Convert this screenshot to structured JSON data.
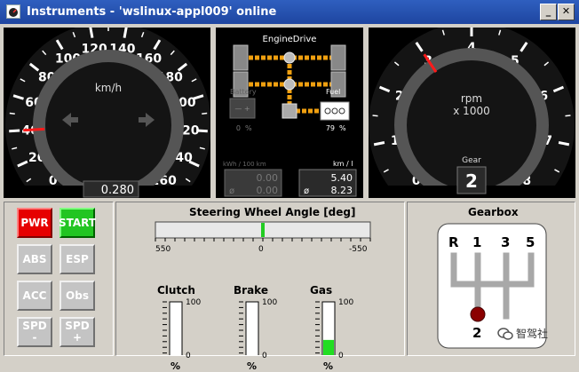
{
  "window": {
    "title": "Instruments - 'wslinux-appl009' online",
    "min_glyph": "_",
    "close_glyph": "✕"
  },
  "speedometer": {
    "unit": "km/h",
    "ticks": [
      "0",
      "20",
      "40",
      "60",
      "80",
      "100",
      "120",
      "140",
      "160",
      "180",
      "200",
      "220",
      "240",
      "260"
    ],
    "needle_value": 40,
    "odometer": "0.280"
  },
  "tachometer": {
    "unit": "rpm",
    "unit_multiplier": "x 1000",
    "ticks": [
      "0",
      "1",
      "2",
      "3",
      "4",
      "5",
      "6",
      "7",
      "8"
    ],
    "needle_value": 3,
    "gear_label": "Gear",
    "gear_value": "2"
  },
  "engine_drive": {
    "title": "EngineDrive",
    "battery_label": "Battery",
    "battery_value": "0",
    "battery_unit": "%",
    "fuel_label": "Fuel",
    "fuel_value": "79",
    "fuel_unit": "%",
    "kwh_label": "kWh / 100 km",
    "kwh_value": "0.00",
    "kwh_avg": "0.00",
    "kml_label": "km / l",
    "kml_value": "5.40",
    "kml_avg": "8.23",
    "avg_symbol": "ø",
    "battery_terminals": "— +"
  },
  "controls": {
    "buttons": [
      "PWR",
      "START",
      "ABS",
      "ESP",
      "ACC",
      "Obs"
    ],
    "spd_minus": [
      "SPD",
      "-"
    ],
    "spd_plus": [
      "SPD",
      "+"
    ]
  },
  "steering": {
    "title": "Steering Wheel Angle [deg]",
    "left_label": "550",
    "center_label": "0",
    "right_label": "-550",
    "value_deg": 0
  },
  "pedals": [
    {
      "name": "Clutch",
      "max_label": "100",
      "min_label": "0",
      "unit": "%",
      "value": 0
    },
    {
      "name": "Brake",
      "max_label": "100",
      "min_label": "0",
      "unit": "%",
      "value": 0
    },
    {
      "name": "Gas",
      "max_label": "100",
      "min_label": "0",
      "unit": "%",
      "value": 0.33,
      "fill_color": "#22dd22"
    }
  ],
  "gearbox": {
    "title": "Gearbox",
    "top_labels": [
      "R",
      "1",
      "3",
      "5"
    ],
    "bottom_labels": [
      "2"
    ],
    "current_gear": "2",
    "knob_color": "#8b0000"
  },
  "watermark": "智驾社",
  "colors": {
    "accent_red": "#ff1a1a",
    "engine_orange": "#f0a010",
    "title_bar": "#1e45a0"
  }
}
